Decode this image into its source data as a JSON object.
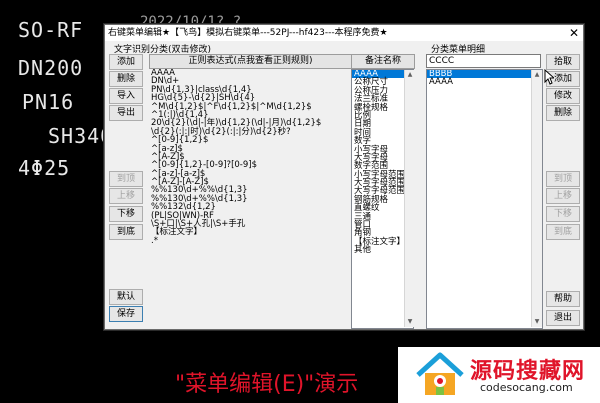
{
  "background_cad": {
    "labels": [
      "SO-RF",
      "DN200",
      "PN16",
      "SH340",
      "4Φ25"
    ],
    "title_fragment": "2022/10/1? ?"
  },
  "dialog": {
    "title": "右键菜单编辑★【飞鸟】模拟右键菜单---52PJ---hf423---本程序免费★",
    "close_glyph": "✕",
    "group_label_left": "文字识别分类(双击修改)",
    "group_label_right": "分类菜单明细",
    "left_buttons": {
      "add": "添加",
      "delete": "删除",
      "import": "导入",
      "export": "导出",
      "top": "到顶",
      "up": "上移",
      "down": "下移",
      "bottom": "到底",
      "default": "默认",
      "save": "保存"
    },
    "header_regex": "正则表达式(点我查看正则规则)",
    "header_menu": "备注名称",
    "regex_rows": [
      "AAAA",
      "DN\\d+",
      "PN\\d{1,3}|class\\d{1,4}",
      "HG\\d{5}-\\d{2}|SH\\d{4}",
      "^M\\d{1,2}$|^F\\d{1,2}$|^M\\d{1,2}$",
      "^1(:|)\\d{1,4}",
      "20\\d{2}(\\d|-|年)\\d{1,2}(\\d|-|月)\\d{1,2}$",
      "\\d{2}(:|:|时)\\d{2}(:|:|分)\\d{2}秒?",
      "^[0-9]{1,2}$",
      "^[a-z]$",
      "^[A-Z]$",
      "^[0-9]{1,2}-[0-9]?[0-9]$",
      "^[a-z]-[a-z]$",
      "^[A-Z]-[A-Z]$",
      "%%130\\d+%%\\d{1,3}",
      "%%130\\d+%%\\d{1,3}",
      "%%132\\d{1,2}",
      "(PL|SO|WN)-RF",
      "\\S+口|\\S+人孔|\\S+手孔",
      "【标注文字】",
      ".*"
    ],
    "menu_rows": [
      "AAAA",
      "公称尺寸",
      "公称压力",
      "法兰标准",
      "螺栓规格",
      "比例",
      "日期",
      "时间",
      "数字",
      "小写字母",
      "大写字母",
      "数字范围",
      "小写字母范围",
      "大写字母范围",
      "大写字母范围",
      "钢筋规格",
      "直螺纹",
      "三通",
      "管口",
      "角钢",
      "【标注文字】",
      "其他"
    ],
    "search_value": "CCCC",
    "detail_rows": [
      "BBBB",
      "AAAA"
    ],
    "right_buttons": {
      "pickup": "拾取",
      "add": "添加",
      "modify": "修改",
      "delete": "删除",
      "top": "到顶",
      "up": "上移",
      "down": "下移",
      "bottom": "到底",
      "help": "帮助",
      "exit": "退出"
    }
  },
  "watermark": {
    "brand": "源码搜藏网",
    "url": "codesocang.com"
  },
  "caption": "\"菜单编辑(E)\"演示"
}
